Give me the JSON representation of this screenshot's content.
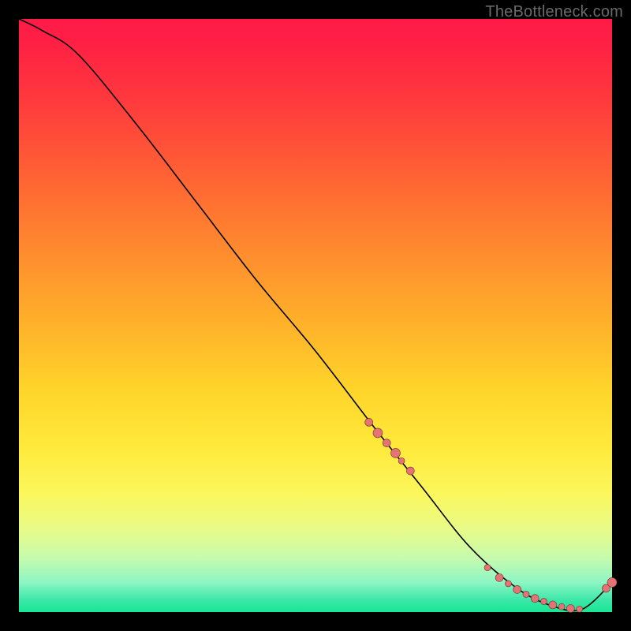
{
  "watermark": "TheBottleneck.com",
  "colors": {
    "marker_fill": "#e57373",
    "marker_stroke": "#6a2f2f",
    "line": "#000000"
  },
  "chart_data": {
    "type": "line",
    "title": "",
    "xlabel": "",
    "ylabel": "",
    "xlim": [
      0,
      100
    ],
    "ylim": [
      0,
      100
    ],
    "grid": false,
    "legend": false,
    "series": [
      {
        "name": "curve",
        "x": [
          0,
          4,
          10,
          20,
          30,
          40,
          50,
          60,
          68,
          76,
          84,
          90,
          95,
          100
        ],
        "values": [
          100,
          98,
          94,
          82,
          69,
          56,
          44,
          31,
          21,
          11,
          4,
          1,
          0.5,
          5
        ]
      }
    ],
    "markers": [
      {
        "x": 59.0,
        "y": 32.0,
        "r": 5
      },
      {
        "x": 60.5,
        "y": 30.2,
        "r": 6
      },
      {
        "x": 62.0,
        "y": 28.5,
        "r": 5
      },
      {
        "x": 63.5,
        "y": 26.8,
        "r": 6
      },
      {
        "x": 64.5,
        "y": 25.5,
        "r": 4
      },
      {
        "x": 66.0,
        "y": 23.8,
        "r": 5
      },
      {
        "x": 79.0,
        "y": 7.5,
        "r": 4
      },
      {
        "x": 81.0,
        "y": 5.8,
        "r": 5
      },
      {
        "x": 82.5,
        "y": 4.8,
        "r": 4
      },
      {
        "x": 84.0,
        "y": 3.8,
        "r": 5
      },
      {
        "x": 85.5,
        "y": 3.0,
        "r": 4
      },
      {
        "x": 87.0,
        "y": 2.3,
        "r": 5
      },
      {
        "x": 88.5,
        "y": 1.8,
        "r": 4
      },
      {
        "x": 90.0,
        "y": 1.2,
        "r": 5
      },
      {
        "x": 91.5,
        "y": 0.9,
        "r": 4
      },
      {
        "x": 93.0,
        "y": 0.6,
        "r": 5
      },
      {
        "x": 94.5,
        "y": 0.5,
        "r": 4
      },
      {
        "x": 99.0,
        "y": 4.0,
        "r": 5
      },
      {
        "x": 100.0,
        "y": 5.0,
        "r": 6
      }
    ]
  }
}
